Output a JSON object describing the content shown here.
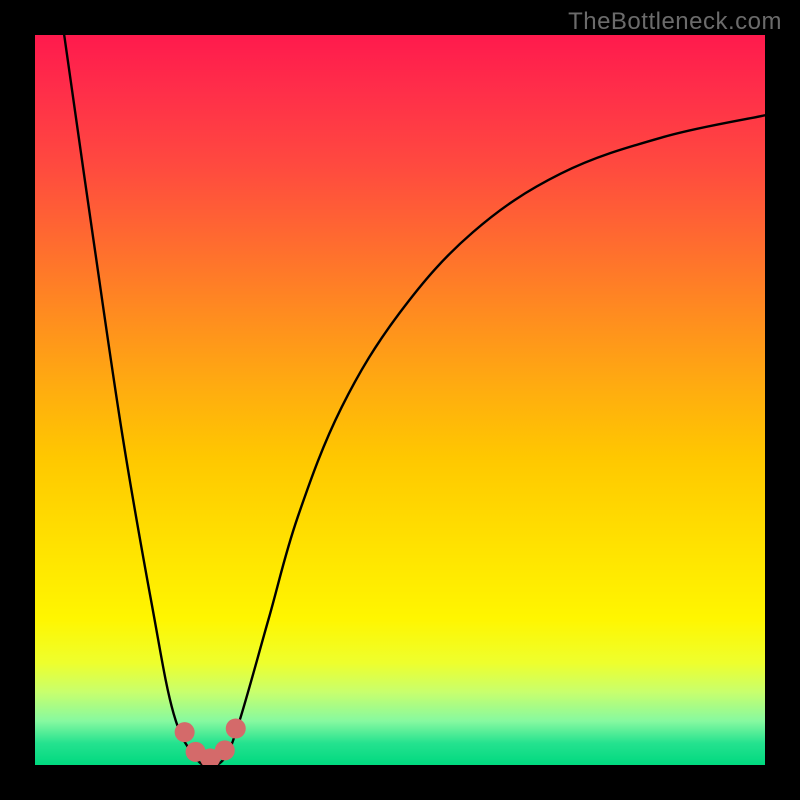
{
  "watermark": "TheBottleneck.com",
  "chart_data": {
    "type": "line",
    "title": "",
    "xlabel": "",
    "ylabel": "",
    "xlim": [
      0,
      100
    ],
    "ylim": [
      0,
      100
    ],
    "series": [
      {
        "name": "bottleneck-curve",
        "x": [
          4,
          8,
          12,
          16,
          19,
          22,
          24,
          26,
          28,
          32,
          36,
          42,
          50,
          60,
          72,
          86,
          100
        ],
        "values": [
          100,
          72,
          45,
          22,
          7,
          1,
          0,
          1,
          6,
          20,
          34,
          49,
          62,
          73,
          81,
          86,
          89
        ]
      }
    ],
    "markers": {
      "name": "highlight-dots",
      "color": "#d46a6a",
      "points": [
        {
          "x": 20.5,
          "y": 4.5
        },
        {
          "x": 22.0,
          "y": 1.8
        },
        {
          "x": 24.0,
          "y": 0.9
        },
        {
          "x": 26.0,
          "y": 2.0
        },
        {
          "x": 27.5,
          "y": 5.0
        }
      ]
    }
  }
}
